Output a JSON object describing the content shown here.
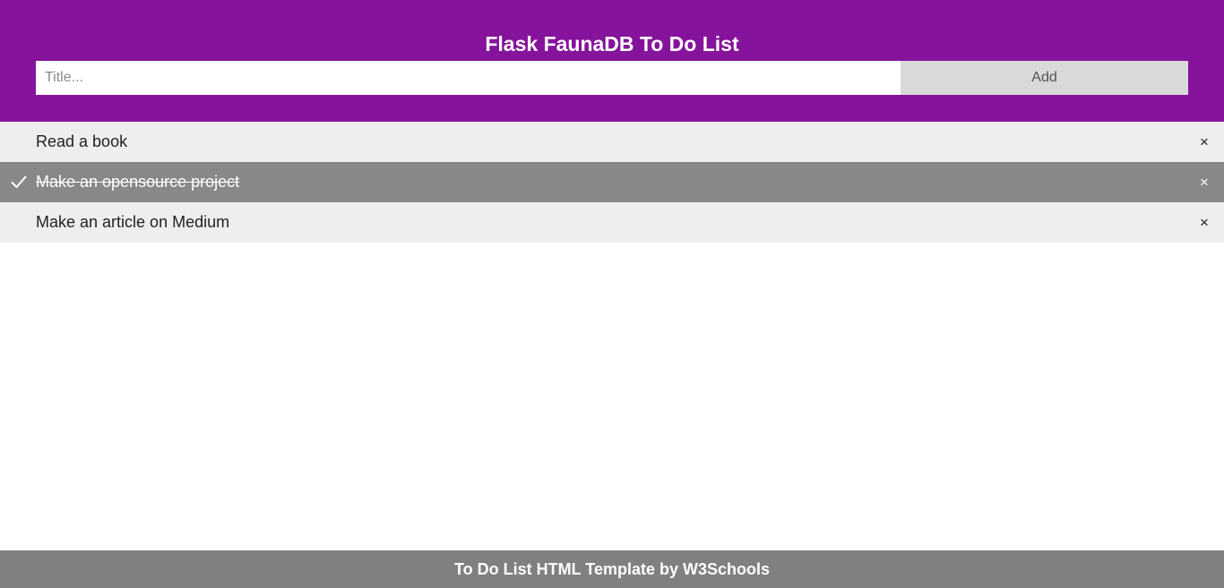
{
  "header": {
    "title": "Flask FaunaDB To Do List",
    "input_placeholder": "Title...",
    "add_label": "Add"
  },
  "todos": [
    {
      "text": "Read a book",
      "checked": false,
      "close": "×"
    },
    {
      "text": "Make an opensource project",
      "checked": true,
      "close": "×"
    },
    {
      "text": "Make an article on Medium",
      "checked": false,
      "close": "×"
    }
  ],
  "footer": {
    "text": "To Do List HTML Template by W3Schools"
  },
  "colors": {
    "header_bg": "#86139b",
    "item_bg": "#eeeeee",
    "checked_bg": "#888888",
    "footer_bg": "#808080",
    "add_button_bg": "#d9d9d9"
  },
  "icons": {
    "checked_marker": "check-icon",
    "delete": "close-icon"
  }
}
